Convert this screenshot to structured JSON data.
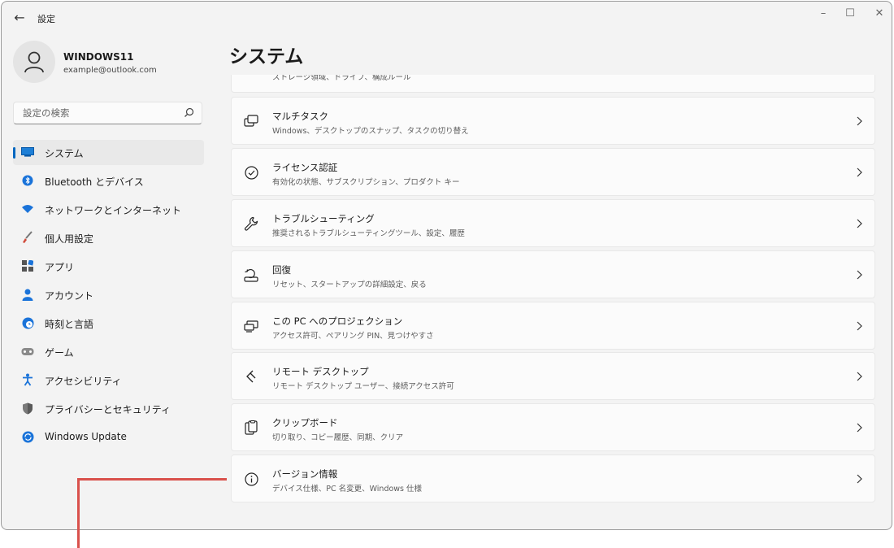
{
  "window": {
    "back_icon": "back-arrow-icon",
    "title": "設定",
    "controls": [
      "minimize-icon",
      "maximize-icon",
      "close-icon"
    ]
  },
  "profile": {
    "name": "WINDOWS11",
    "email": "example@outlook.com",
    "avatar_icon": "person-icon"
  },
  "search": {
    "placeholder": "設定の検索",
    "icon": "search-icon"
  },
  "sidebar": {
    "items": [
      {
        "label": "システム",
        "icon": "system-icon",
        "active": true
      },
      {
        "label": "Bluetooth とデバイス",
        "icon": "bluetooth-icon"
      },
      {
        "label": "ネットワークとインターネット",
        "icon": "wifi-icon"
      },
      {
        "label": "個人用設定",
        "icon": "brush-icon"
      },
      {
        "label": "アプリ",
        "icon": "apps-icon"
      },
      {
        "label": "アカウント",
        "icon": "account-icon"
      },
      {
        "label": "時刻と言語",
        "icon": "clock-globe-icon"
      },
      {
        "label": "ゲーム",
        "icon": "gamepad-icon"
      },
      {
        "label": "アクセシビリティ",
        "icon": "accessibility-icon"
      },
      {
        "label": "プライバシーとセキュリティ",
        "icon": "shield-icon"
      },
      {
        "label": "Windows Update",
        "icon": "windows-update-icon"
      }
    ]
  },
  "main": {
    "title": "システム",
    "partial_row_desc": "ストレージ領域、ドライブ、構成ルール",
    "rows": [
      {
        "title": "マルチタスク",
        "desc": "Windows、デスクトップのスナップ、タスクの切り替え",
        "icon": "multitask-icon"
      },
      {
        "title": "ライセンス認証",
        "desc": "有効化の状態、サブスクリプション、プロダクト キー",
        "icon": "check-circle-icon"
      },
      {
        "title": "トラブルシューティング",
        "desc": "推奨されるトラブルシューティングツール、設定、履歴",
        "icon": "wrench-icon"
      },
      {
        "title": "回復",
        "desc": "リセット、スタートアップの詳細設定、戻る",
        "icon": "recovery-icon"
      },
      {
        "title": "この PC へのプロジェクション",
        "desc": "アクセス許可、ペアリング PIN、見つけやすさ",
        "icon": "projection-icon"
      },
      {
        "title": "リモート デスクトップ",
        "desc": "リモート デスクトップ ユーザー、接続アクセス許可",
        "icon": "remote-desktop-icon"
      },
      {
        "title": "クリップボード",
        "desc": "切り取り、コピー履歴、同期、クリア",
        "icon": "clipboard-icon"
      },
      {
        "title": "バージョン情報",
        "desc": "デバイス仕様、PC 名変更、Windows 仕様",
        "icon": "info-icon"
      }
    ]
  },
  "colors": {
    "accent": "#0067c0",
    "annotation": "#d9514c",
    "window_bg": "#f3f3f3",
    "card_bg": "#fbfbfb"
  }
}
